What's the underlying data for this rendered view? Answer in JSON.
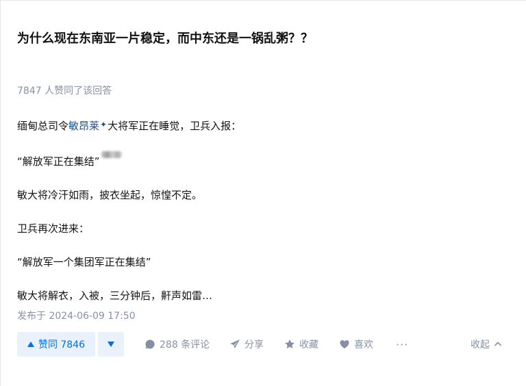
{
  "question": {
    "title": "为什么现在东南亚一片稳定，而中东还是一锅乱粥？？"
  },
  "answer": {
    "vote_summary": "7847 人赞同了该回答",
    "paragraphs": {
      "p1_before": "缅甸总司令",
      "p1_mention": "敏昂莱",
      "p1_after": "大将军正在睡觉，卫兵入报：",
      "p2": "“解放军正在集结”",
      "p3": "敏大将冷汗如雨，披衣坐起，惊惶不定。",
      "p4": "卫兵再次进来：",
      "p5": "“解放军一个集团军正在集结”",
      "p6": "敏大将解衣，入被，三分钟后，鼾声如雷…"
    },
    "publish_time": "发布于 2024-06-09 17:50"
  },
  "actions": {
    "vote_up_label": "赞同 7846",
    "comment_label": "288 条评论",
    "share_label": "分享",
    "favorite_label": "收藏",
    "like_label": "喜欢",
    "more_label": "···",
    "collapse_label": "收起"
  },
  "colors": {
    "primary_blue": "#056de8",
    "link_blue": "#175199",
    "meta_gray": "#8590a6",
    "vote_bg": "#e8f1fc"
  }
}
